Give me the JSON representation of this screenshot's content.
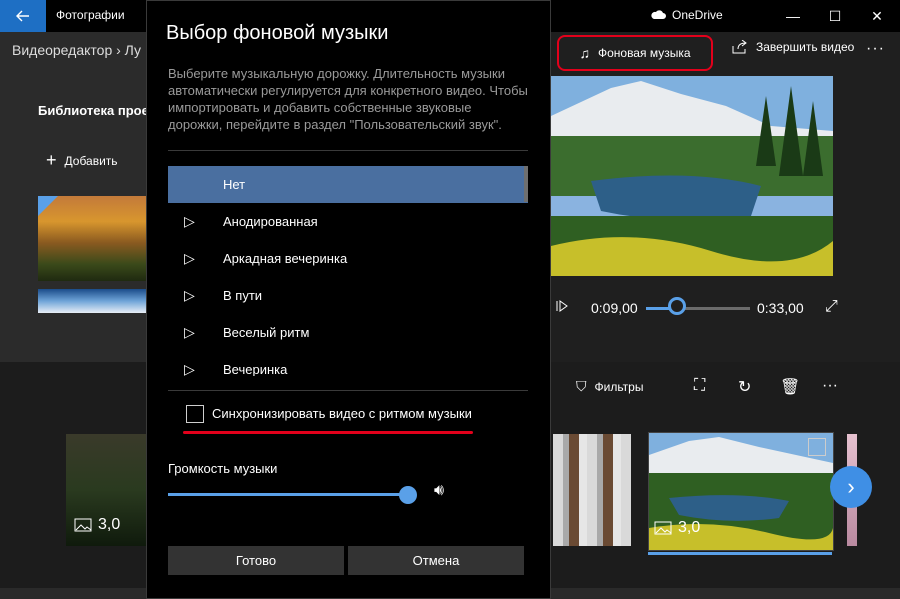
{
  "titlebar": {
    "app_title": "Фотографии",
    "onedrive_label": "OneDrive",
    "back_icon": "back-arrow-icon",
    "minimize": "—",
    "maximize": "☐",
    "close": "✕"
  },
  "editor": {
    "breadcrumb": "Видеоредактор  ›  Лу",
    "library_title": "Библиотека прое",
    "add_label": "Добавить",
    "bg_music_label": "Фоновая музыка",
    "finish_video_label": "Завершить видео",
    "more_label": "···",
    "current_time": "0:09,00",
    "total_time": "0:33,00",
    "progress_fraction": 0.27,
    "filters_label": "Фильтры",
    "clip1_duration": "3,0",
    "clip2_duration": "3,0"
  },
  "dialog": {
    "title": "Выбор фоновой музыки",
    "description": "Выберите музыкальную дорожку. Длительность музыки автоматически регулируется для конкретного видео. Чтобы импортировать и добавить собственные звуковые дорожки, перейдите в раздел \"Пользовательский звук\".",
    "tracks": [
      "Нет",
      "Анодированная",
      "Аркадная вечеринка",
      "В пути",
      "Веселый ритм",
      "Вечеринка"
    ],
    "selected_index": 0,
    "sync_label": "Синхронизировать видео с ритмом музыки",
    "sync_checked": false,
    "volume_label": "Громкость музыки",
    "volume_fraction": 1.0,
    "ok_label": "Готово",
    "cancel_label": "Отмена"
  },
  "colors": {
    "accent": "#5aa0e8",
    "highlight_red": "#e3001b",
    "selected_row": "#4a6fa0"
  }
}
